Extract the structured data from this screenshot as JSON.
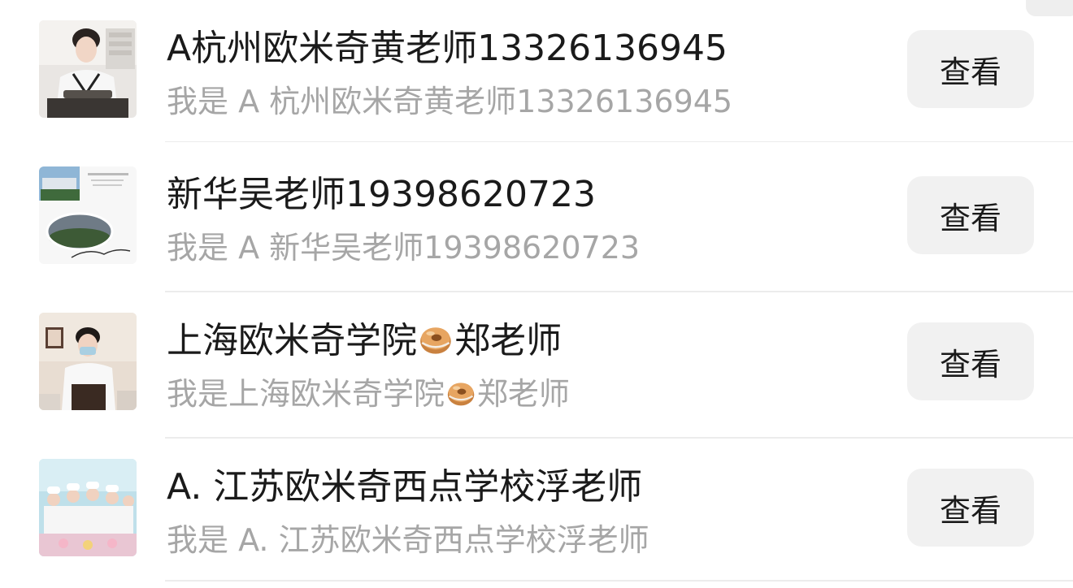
{
  "contacts": [
    {
      "title": "A杭州欧米奇黄老师13326136945",
      "subtitle": "我是 A 杭州欧米奇黄老师13326136945",
      "button": "查看",
      "avatar_icon": "chef-woman-photo"
    },
    {
      "title": "新华吴老师19398620723",
      "subtitle": "我是 A 新华吴老师19398620723",
      "button": "查看",
      "avatar_icon": "campus-sakura-photo"
    },
    {
      "title_before_emoji": "上海欧米奇学院",
      "title_after_emoji": "郑老师",
      "subtitle_before_emoji": "我是上海欧米奇学院",
      "subtitle_after_emoji": "郑老师",
      "emoji": "bagel-emoji",
      "button": "查看",
      "avatar_icon": "chef-masked-photo"
    },
    {
      "title": "A. 江苏欧米奇西点学校浮老师",
      "subtitle": "我是 A. 江苏欧米奇西点学校浮老师",
      "button": "查看",
      "avatar_icon": "group-chefs-photo"
    }
  ],
  "colors": {
    "title": "#1a1a1a",
    "subtitle": "#a6a6a6",
    "button_bg": "#f1f1f1",
    "divider": "#ececec"
  }
}
